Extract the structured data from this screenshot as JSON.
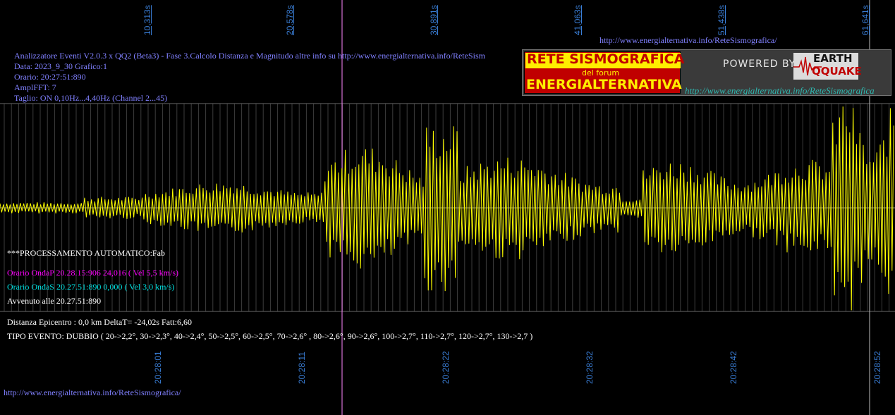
{
  "header": {
    "url_top": "http://www.energialternativa.info/ReteSismografica/",
    "line_title": "Analizzatore Eventi V2.0.3 x QQ2 (Beta3) - Fase 3.Calcolo Distanza e Magnitudo altre info su http://www.energialternativa.info/ReteSism",
    "line_data": "Data: 2023_9_30 Grafico:1",
    "line_orario": "Orario: 20:27:51:890",
    "line_ampl": "AmplFFT: 7",
    "line_taglio": "Taglio: ON 0,10Hz...4,40Hz       (Channel 2...45)"
  },
  "top_ticks": [
    "10,313s",
    "20,578s",
    "30,891s",
    "41,063s",
    "51,438s",
    "61,641s"
  ],
  "bottom_ticks": [
    "20:28:01",
    "20:28:11",
    "20:28:22",
    "20:28:32",
    "20:28:42",
    "20:28:52"
  ],
  "logo": {
    "line1": "RETE SISMOGRAFICA",
    "line2": "del forum",
    "line3": "ENERGIALTERNATIVA",
    "powered": "POWERED BY:",
    "brand1": "EARTH",
    "brand2": "QQUAKE",
    "url": "http://www.energialternativa.info/ReteSismografica"
  },
  "processing": {
    "label": "***PROCESSAMENTO AUTOMATICO:Fab",
    "onda_p": "Orario OndaP 20.28.15:906  24,016 ( Vel 5,5 km/s)",
    "onda_s": "Orario OndaS 20.27.51:890  0,000 ( Vel 3,0 km/s)",
    "avvenuto": "Avvenuto alle 20.27.51:890",
    "distanza": "Distanza Epicentro : 0,0 km DeltaT= -24,02s  Fatt:6,60",
    "tipo_evento": "TIPO EVENTO: DUBBIO ( 20->2,2°, 30->2,3°, 40->2,4°, 50->2,5°, 60->2,5°, 70->2,6° , 80->2,6°, 90->2,6°, 100->2,7°, 110->2,7°, 120->2,7°, 130->2,7 )"
  },
  "footer": {
    "url": "http://www.energialternativa.info/ReteSismografica/"
  },
  "colors": {
    "background": "#000000",
    "trace": "#ffff00",
    "grid": "#5a5a5a",
    "onda_p_marker": "#ff66ff",
    "onda_p_text": "#ff00ff",
    "onda_s_text": "#00e0e0",
    "tick_text": "#3a7fd8",
    "info_text": "#8080ff"
  }
}
